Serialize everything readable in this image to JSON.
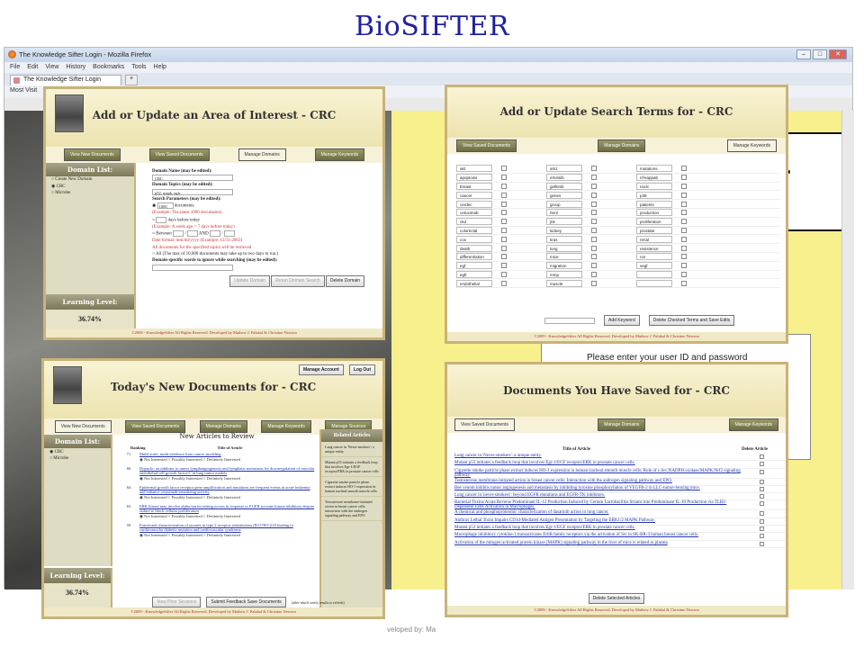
{
  "slide_title": "BioSIFTER",
  "browser": {
    "title": "The Knowledge Sifter Login - Mozilla Firefox",
    "menu": [
      "File",
      "Edit",
      "View",
      "History",
      "Bookmarks",
      "Tools",
      "Help"
    ],
    "tab": "The Knowledge Sifter Login",
    "new_tab": "+",
    "bookmarks_label": "Most Visit",
    "win_min": "–",
    "win_max": "□",
    "win_close": "✕"
  },
  "background": {
    "right_box_text": "er",
    "login_prompt": "Please enter your user ID and password",
    "dev_credit": "veloped by: Ma"
  },
  "panel_domain": {
    "title": "Add or Update an Area of Interest - CRC",
    "nav": [
      "View New Documents",
      "View Saved Documents",
      "Manage Domains",
      "Manage Keywords"
    ],
    "domain_list_title": "Domain List:",
    "domains": [
      "Create New Domain",
      "CRC",
      "Microbe"
    ],
    "learning_title": "Learning Level:",
    "learning_value": "36.74%",
    "name_label": "Domain Name (may be edited):",
    "name_value": "CRC",
    "topics_label": "Domain Topics (may be edited):",
    "topics_value": "p52, mapk, egfr",
    "search_label": "Search Parameters (may be edited):",
    "docs_value": "1000",
    "docs_label": "documents",
    "docs_example": "(Example: The latest 1000 documents)",
    "days_label": "days before today",
    "days_example": "(Example: A week ago = 7 days before today)",
    "between_label": "Between",
    "and_label": "AND",
    "date_format": "Date format: mm/dd/yyyy (Example: 12/31/2003)",
    "all_docs_note": "All documents for the specified topics will be retrieved",
    "all_label": "All (The max of 10,000 documents may take up to two days to run.)",
    "ignore_label": "Domain-specific words to ignore while searching (may be edited):",
    "buttons": [
      "Update Domain",
      "Rerun Domain Search",
      "Delete Domain"
    ],
    "footer": "©2009 - KnowledgeSifter All Rights Reserved. Developed by Mathew J. Palakal & Christine Newton"
  },
  "panel_terms": {
    "title": "Add or Update Search Terms for - CRC",
    "nav": [
      "View Saved Documents",
      "Manage Domains",
      "Manage Keywords"
    ],
    "rows": [
      [
        "akt",
        "ark1",
        "mutations"
      ],
      [
        "apoptosis",
        "erlotinib",
        "nf-kappab"
      ],
      [
        "breast",
        "gefitinib",
        "nsclc"
      ],
      [
        "cancer",
        "genes",
        "p38"
      ],
      [
        "cerdec",
        "group",
        "patients"
      ],
      [
        "cetuximab",
        "her2",
        "production"
      ],
      [
        "ckd",
        "jnk",
        "proliferation"
      ],
      [
        "colorectal",
        "kidney",
        "prostate"
      ],
      [
        "cox",
        "kras",
        "renal"
      ],
      [
        "death",
        "lung",
        "resistence"
      ],
      [
        "differentiation",
        "mice",
        "ros"
      ],
      [
        "egf",
        "migration",
        "vegf"
      ],
      [
        "egfr",
        "mmp",
        ""
      ],
      [
        "endothelial",
        "muscle",
        ""
      ]
    ],
    "buttons": [
      "Add Keyword",
      "Delete Checked Terms and Save Edits"
    ],
    "footer": "©2009 - KnowledgeSifter All Rights Reserved. Developed by Mathew J. Palakal & Christine Newton"
  },
  "panel_today": {
    "title": "Today's New Documents for - CRC",
    "top_buttons": [
      "Manage Account",
      "Log Out"
    ],
    "nav": [
      "View New Documents",
      "View Saved Documents",
      "Manage Domains",
      "Manage Keywords",
      "Manage Sources"
    ],
    "domain_list_title": "Domain List:",
    "domains": [
      "CRC",
      "Microbe"
    ],
    "learning_title": "Learning Level:",
    "learning_value": "36.74%",
    "list_title": "New Articles to Review",
    "col_rank": "Ranking",
    "col_title": "Title of Article",
    "rating": "◉ Not Interested   ○ Possibly Interested   ○ Definitely Interested",
    "articles": [
      {
        "rank": "71",
        "title": "Multi-scale, multi-evidence from cancer modeling"
      },
      {
        "rank": "66",
        "title": "Dopaclo- an inhibitor to tumor lymphangiogenesis and lymphatic metastasis for downregulation of vascular endothelial cell growth factor-C in lung tumor models"
      },
      {
        "rank": "64",
        "title": "Epidermal growth factor receptor gene amplification and mutations are frequent events in acute leukemia and enhance cetuximab-sensitizing activity"
      },
      {
        "rank": "63",
        "title": "ERK kinase may involve alpha-tarrier-setting occurs in response to EGFR tyrosine kinase inhibitors despite failure to block cellular proliferation"
      },
      {
        "rank": "59",
        "title": "Functional characterization of taxanes in type 2 receptor substitutions (R117H/C)G0 leading to cardiovascular diabetic mutation and cardiovascular syndrome"
      }
    ],
    "related_title": "Related Articles",
    "related": [
      "Lung cancer in 'Never-smokers': a unique entity",
      "Mutant p53 initiates a feedback loop that involves Egr-1/EGF receptor/ERK in prostate cancer cells",
      "Cigarette smoke particle phase extract induces HO-1 expression in human tracheal smooth muscle cells",
      "Testosterone membrane-initiated action in breast cancer cells: interaction with the androgen signaling pathway and EPO"
    ],
    "bottom_buttons": [
      "View Prior Sessions",
      "Submit Feedback Save Documents"
    ],
    "bottom_note": "(after which verify results to refresh)",
    "footer": "©2009 - KnowledgeSifter All Rights Reserved. Developed by Mathew J. Palakal & Christine Newton"
  },
  "panel_saved": {
    "title": "Documents You Have Saved for - CRC",
    "nav": [
      "View Saved Documents",
      "Manage Domains",
      "Manage Keywords"
    ],
    "col_title": "Title of Article",
    "col_delete": "Delete Article",
    "articles": [
      "Lung cancer in 'Never-smokers': a unique entity.",
      "Mutant p53 initiates a feedback loop that involves Egr-1/EGF receptor/ERK in prostate cancer cells.",
      "Cigarette smoke particle phase extract induces HO-1 expression in human tracheal smooth muscle cells: Role of c-Src/NADPH oxidase/MAPK/Nrf2 signaling pathway.",
      "Testosterone membrane-initiated action in breast cancer cells: Interaction with the androgen signaling pathway and EPO.",
      "Bee venom inhibits tumor angiogenesis and metastasis by inhibiting tyrosine phosphorylation of VEGFR-2 in LLC-tumor-bearing mice.",
      "Lung cancer in 'never-smokers': beyond EGFR mutations and EGFR-TK inhibitors.",
      "Bacterial Toxins Acute Reverse Predominant IL-12 Production Induced by Certain Lactobacillus Strains into Predominant IL-10 Production via TLR2-Dependent ERK Activation in Macrophages.",
      "A chemical and phosphoproteomic characterization of dasatinib action in lung cancer.",
      "Anthrax Lethal Toxin Impairs CD1d-Mediated Antigen Presentation by Targeting the ERK1/2 MAPK Pathway.",
      "Mutant p53 initiates a feedback loop that involves Egr-1/EGF receptor/ERK in prostate cancer cells.",
      "Macrophage inhibitory cytokine-1 transactivates ErbB family receptors via the activation of Src in SK-BR-3 human breast cancer cells.",
      "Activation of the mitogen-activated protein kinase (MAPK) signaling pathway in the liver of mice is related to plasma"
    ],
    "button": "Delete Selected Articles",
    "footer": "©2009 - KnowledgeSifter All Rights Reserved. Developed by Mathew J. Palakal & Christine Newton"
  }
}
